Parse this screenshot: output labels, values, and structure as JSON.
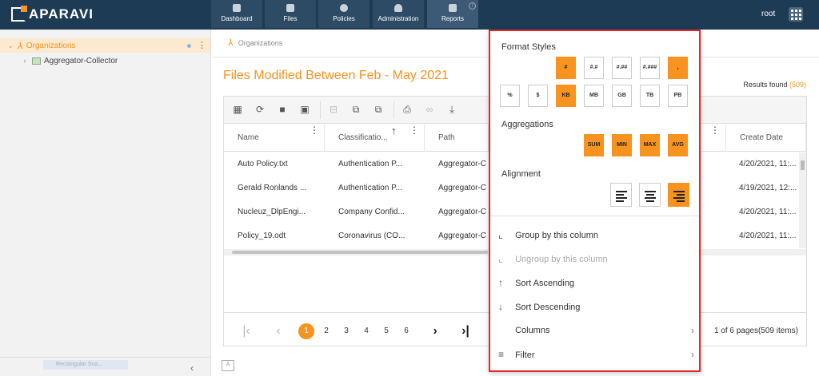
{
  "app": {
    "logo_text": "APARAVI",
    "user": "root"
  },
  "nav": [
    {
      "label": "Dashboard",
      "icon": "dashboard-icon"
    },
    {
      "label": "Files",
      "icon": "folder-icon"
    },
    {
      "label": "Policies",
      "icon": "gear-icon"
    },
    {
      "label": "Administration",
      "icon": "users-icon"
    },
    {
      "label": "Reports",
      "icon": "clipboard-icon"
    }
  ],
  "active_nav": "Reports",
  "sidebar": {
    "items": [
      {
        "label": "Organizations",
        "icon": "organization-icon"
      },
      {
        "label": "Aggregator-Collector",
        "icon": "aggregator-icon"
      }
    ],
    "ghost_label": "Rectangular Sna..."
  },
  "breadcrumb": "Organizations",
  "page": {
    "title": "Files Modified Between Feb - May 2021",
    "results_label": "Results found",
    "results_count": "(509)"
  },
  "table": {
    "columns": [
      "Name",
      "Classificatio...",
      "Path",
      "Create Date"
    ],
    "rows": [
      [
        "Auto Policy.txt",
        "Authentication P...",
        "Aggregator-C",
        "4/20/2021, 11:..."
      ],
      [
        "Gerald Ronlands ...",
        "Authentication P...",
        "Aggregator-C",
        "4/19/2021, 12:..."
      ],
      [
        "Nucleuz_DlpEngi...",
        "Company Confid...",
        "Aggregator-C",
        "4/20/2021, 11:..."
      ],
      [
        "Policy_19.odt",
        "Coronavirus (CO...",
        "Aggregator-C",
        "4/20/2021, 11:..."
      ]
    ]
  },
  "pager": {
    "pages": [
      "1",
      "2",
      "3",
      "4",
      "5",
      "6"
    ],
    "current": "1",
    "info": "1 of 6 pages(509 items)"
  },
  "menu": {
    "format_styles_title": "Format Styles",
    "format_row1": [
      "#",
      "#.#",
      "#.##",
      "#.###",
      ","
    ],
    "format_row2": [
      "%",
      "$",
      "KB",
      "MB",
      "GB",
      "TB",
      "PB"
    ],
    "aggregations_title": "Aggregations",
    "aggregations": [
      "SUM",
      "MIN",
      "MAX",
      "AVG"
    ],
    "alignment_title": "Alignment",
    "items": [
      {
        "label": "Group by this column",
        "icon": "group-icon",
        "enabled": true
      },
      {
        "label": "Ungroup by this column",
        "icon": "ungroup-icon",
        "enabled": false
      },
      {
        "label": "Sort Ascending",
        "icon": "arrow-up-icon",
        "enabled": true
      },
      {
        "label": "Sort Descending",
        "icon": "arrow-down-icon",
        "enabled": true
      },
      {
        "label": "Columns",
        "icon": "",
        "enabled": true
      },
      {
        "label": "Filter",
        "icon": "filter-icon",
        "enabled": true
      }
    ]
  },
  "colors": {
    "accent": "#f7931e",
    "topbar": "#1e3b56",
    "highlight_border": "#e0272a"
  }
}
